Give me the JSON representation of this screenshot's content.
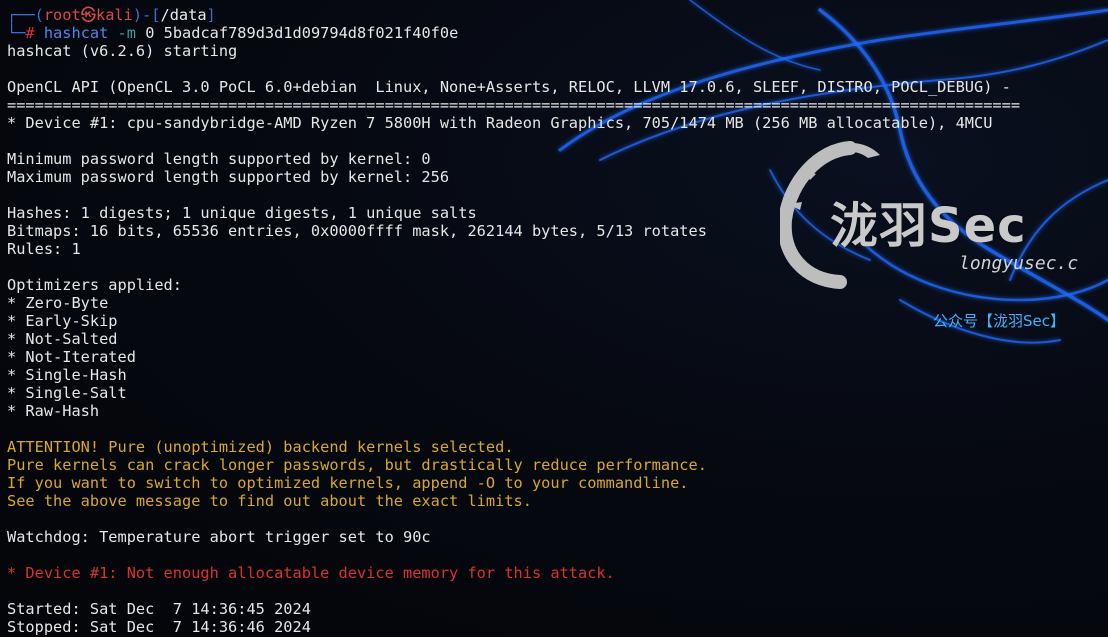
{
  "terminal": {
    "prompt": {
      "corner_top": "┌──(",
      "user": "root",
      "skull": "㉿",
      "host": "kali",
      "sep": ")-[",
      "path": "/data",
      "close": "]",
      "corner_bottom": "└─",
      "hash": "#",
      "command": "hashcat",
      "flag": "-m",
      "args": "0 5badcaf789d3d1d09794d8f021f40f0e"
    },
    "output": {
      "version_line": "hashcat (v6.2.6) starting",
      "opencl_line": "OpenCL API (OpenCL 3.0 PoCL 6.0+debian  Linux, None+Asserts, RELOC, LLVM 17.0.6, SLEEF, DISTRO, POCL_DEBUG) -",
      "rule_line": "==============================================================================================================",
      "device_line": "* Device #1: cpu-sandybridge-AMD Ryzen 7 5800H with Radeon Graphics, 705/1474 MB (256 MB allocatable), 4MCU",
      "min_pw": "Minimum password length supported by kernel: 0",
      "max_pw": "Maximum password length supported by kernel: 256",
      "hashes": "Hashes: 1 digests; 1 unique digests, 1 unique salts",
      "bitmaps": "Bitmaps: 16 bits, 65536 entries, 0x0000ffff mask, 262144 bytes, 5/13 rotates",
      "rules": "Rules: 1",
      "optimizers_title": "Optimizers applied:",
      "optimizers": [
        "* Zero-Byte",
        "* Early-Skip",
        "* Not-Salted",
        "* Not-Iterated",
        "* Single-Hash",
        "* Single-Salt",
        "* Raw-Hash"
      ],
      "attention": [
        "ATTENTION! Pure (unoptimized) backend kernels selected.",
        "Pure kernels can crack longer passwords, but drastically reduce performance.",
        "If you want to switch to optimized kernels, append -O to your commandline.",
        "See the above message to find out about the exact limits."
      ],
      "watchdog": "Watchdog: Temperature abort trigger set to 90c",
      "error": "* Device #1: Not enough allocatable device memory for this attack.",
      "started": "Started: Sat Dec  7 14:36:45 2024",
      "stopped": "Stopped: Sat Dec  7 14:36:46 2024"
    }
  },
  "watermark": {
    "brand": "泷羽Sec",
    "domain": "longyusec.c",
    "account": "公众号【泷羽Sec】"
  },
  "colors": {
    "background": "#05070d",
    "prompt_frame": "#3b6fd8",
    "root_kali": "#e04848",
    "command": "#4f86e8",
    "warning": "#d9a825",
    "error": "#d83232",
    "text": "#e6e6e6",
    "dragon_glow": "#1f6bff"
  }
}
